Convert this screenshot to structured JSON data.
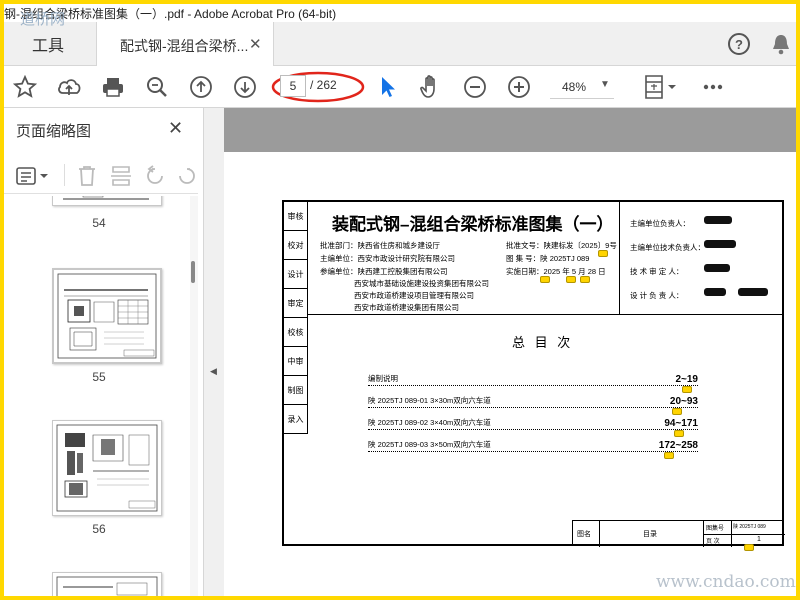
{
  "window": {
    "title": "钢-混组合梁桥标准图集（一）.pdf - Adobe Acrobat Pro (64-bit)",
    "watermark_top": "道桥网"
  },
  "tabs": {
    "tools_label": "工具",
    "document_label": "配式钢-混组合梁桥..."
  },
  "toolbar": {
    "current_page": "5",
    "total_pages": "/ 262",
    "zoom": "48%"
  },
  "sidebar": {
    "title": "页面缩略图",
    "thumbnails": [
      {
        "label": "54"
      },
      {
        "label": "55"
      },
      {
        "label": "56"
      }
    ]
  },
  "sheet": {
    "title": "装配式钢–混组合梁桥标准图集（一）",
    "approval_dept": "批准部门：陕西省住房和城乡建设厅",
    "lead_unit": "主编单位：西安市政设计研究院有限公司",
    "participants": "参编单位：陕西建工控股集团有限公司",
    "participant2": "西安城市基础设施建设投资集团有限公司",
    "participant3": "西安市政道桥建设项目管理有限公司",
    "participant4": "西安市政道桥建设集团有限公司",
    "approval_doc": "批准文号：陕建标发〔2025〕9号",
    "atlas_no": "图 集 号：陕 2025TJ  089",
    "impl_date": "实施日期：2025 年 5 月 28 日",
    "sig_labels": [
      "主编单位负责人：",
      "主编单位技术负责人：",
      "技 术 审 定 人：",
      "设 计 负 责 人："
    ],
    "binding_cells": [
      "审核",
      "校对",
      "设计",
      "审定",
      "校核",
      "中审",
      "制图",
      "录入"
    ],
    "toc_heading": "总 目 次",
    "toc": [
      {
        "name": "编制说明",
        "pages": "2~19"
      },
      {
        "name": "陕 2025TJ  089-01  3×30m双向六车道",
        "pages": "20~93"
      },
      {
        "name": "陕 2025TJ  089-02  3×40m双向六车道",
        "pages": "94~171"
      },
      {
        "name": "陕 2025TJ  089-03  3×50m双向六车道",
        "pages": "172~258"
      }
    ],
    "tb_name_label": "图名",
    "tb_name_value": "目录",
    "tb_atlas_label": "图集号",
    "tb_atlas_value": "陕 2025TJ 089",
    "tb_page_label": "页  次",
    "tb_page_value": "1"
  },
  "watermark_bottom": "www.cndao.com"
}
